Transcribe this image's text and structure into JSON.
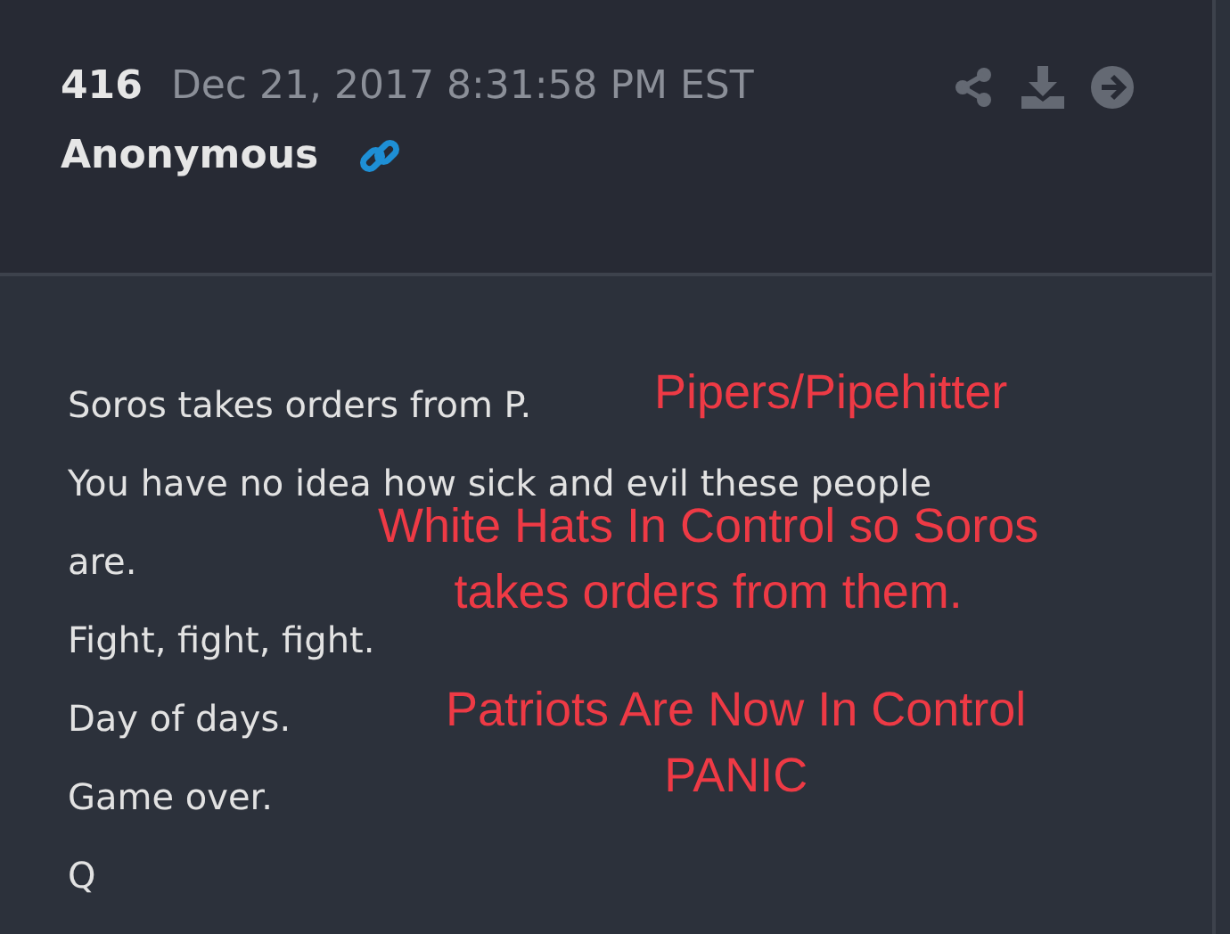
{
  "post": {
    "number": "416",
    "date": "Dec 21, 2017 8:31:58 PM EST",
    "author": "Anonymous",
    "lines": [
      "Soros takes orders from P.",
      "You have no idea how sick and evil these people",
      "are.",
      "Fight, fight, fight.",
      "Day of days.",
      "Game over.",
      "Q"
    ]
  },
  "annotations": [
    {
      "lines": [
        "Pipers/Pipehitter"
      ],
      "color": "#ee3a45"
    },
    {
      "lines": [
        "White Hats In Control so Soros",
        "takes orders from them."
      ],
      "color": "#ee3a45"
    },
    {
      "lines": [
        "Patriots Are Now In Control",
        "PANIC"
      ],
      "color": "#ee3a45"
    }
  ]
}
